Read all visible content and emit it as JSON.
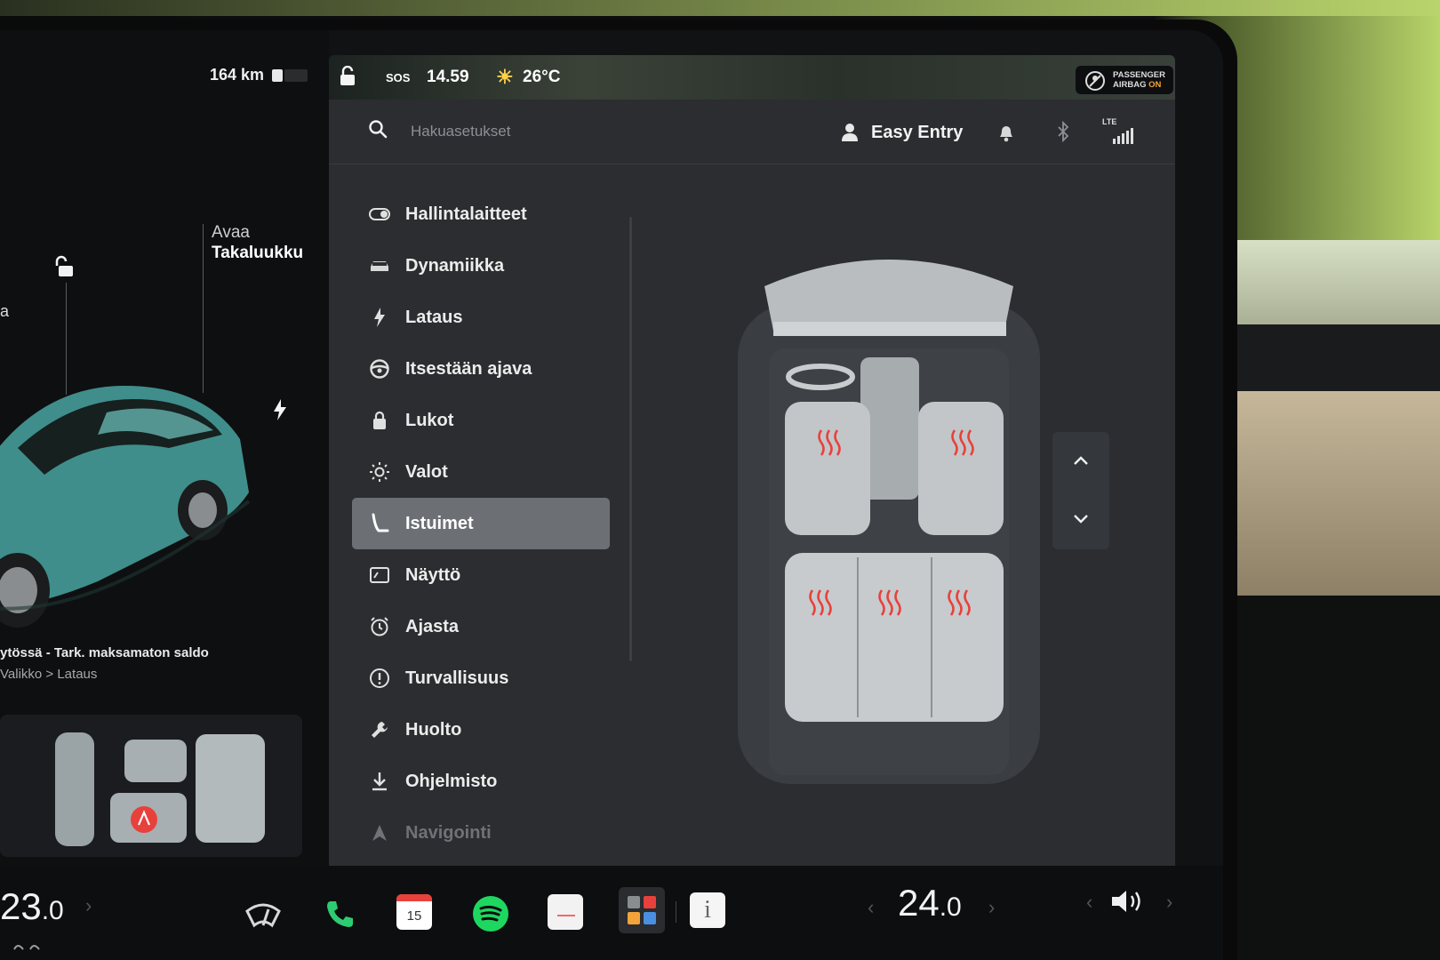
{
  "status": {
    "range": "164 km",
    "sos": "SOS",
    "time": "14.59",
    "outside_temp": "26°C",
    "airbag_line1": "PASSENGER",
    "airbag_line2": "AIRBAG",
    "airbag_state": "ON"
  },
  "car_panel": {
    "trunk_label_1": "Avaa",
    "trunk_label_2": "Takaluukku",
    "left_fragment": "a",
    "notice": "ytössä - Tark. maksamaton saldo",
    "notice_path": "Valikko > Lataus"
  },
  "search": {
    "placeholder": "Hakuasetukset"
  },
  "profile": {
    "name": "Easy Entry"
  },
  "signal": {
    "lte": "LTE"
  },
  "menu": [
    {
      "label": "Hallintalaitteet",
      "icon": "toggle-icon"
    },
    {
      "label": "Dynamiikka",
      "icon": "car-icon"
    },
    {
      "label": "Lataus",
      "icon": "bolt-icon"
    },
    {
      "label": "Itsestään ajava",
      "icon": "steering-wheel-icon"
    },
    {
      "label": "Lukot",
      "icon": "lock-icon"
    },
    {
      "label": "Valot",
      "icon": "sun-icon"
    },
    {
      "label": "Istuimet",
      "icon": "seat-icon",
      "active": true
    },
    {
      "label": "Näyttö",
      "icon": "display-icon"
    },
    {
      "label": "Ajasta",
      "icon": "alarm-icon"
    },
    {
      "label": "Turvallisuus",
      "icon": "alert-icon"
    },
    {
      "label": "Huolto",
      "icon": "wrench-icon"
    },
    {
      "label": "Ohjelmisto",
      "icon": "download-icon"
    },
    {
      "label": "Navigointi",
      "icon": "navigation-icon"
    }
  ],
  "bottom": {
    "driver_temp_int": "23",
    "driver_temp_dec": ".0",
    "passenger_temp_int": "24",
    "passenger_temp_dec": ".0",
    "calendar_day": "15"
  },
  "colors": {
    "heat_red": "#e8413c",
    "active_menu": "#6c6f74",
    "spotify_green": "#1ed760",
    "phone_green": "#2ecc71"
  }
}
